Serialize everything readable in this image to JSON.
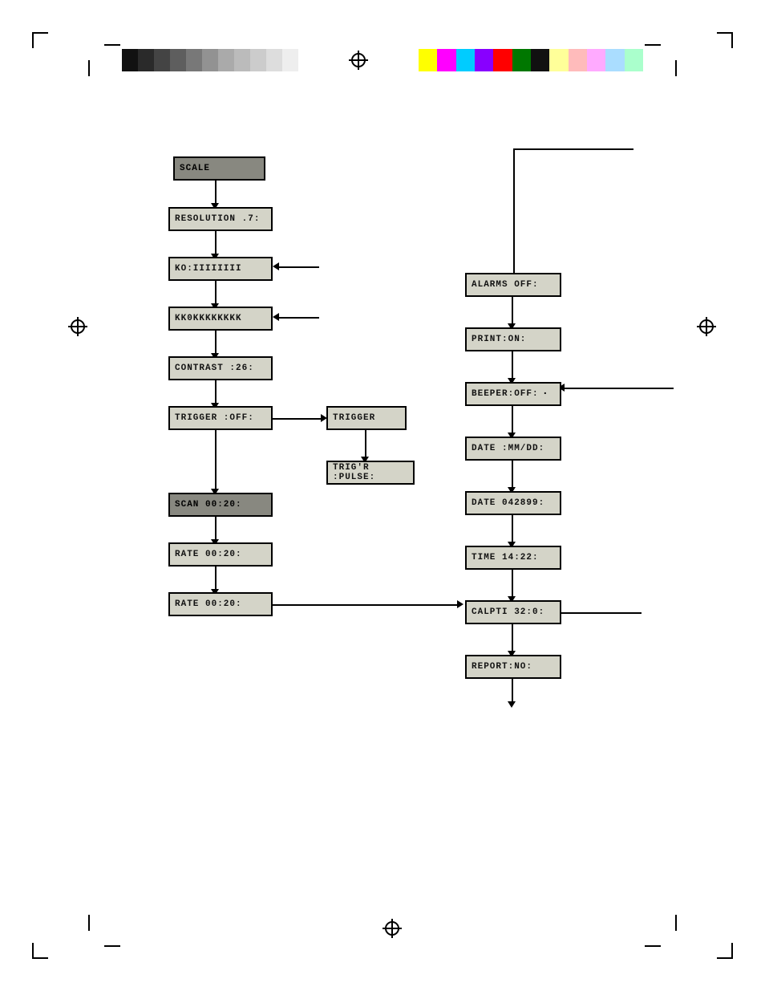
{
  "colorBars": {
    "grayscale": [
      "#111111",
      "#333333",
      "#555555",
      "#777777",
      "#999999",
      "#aaaaaa",
      "#bbbbbb",
      "#cccccc",
      "#dddddd",
      "#eeeeee",
      "#ffffff"
    ],
    "colors": [
      "#ffff00",
      "#ff00ff",
      "#00ffff",
      "#0000ff",
      "#ff0000",
      "#00aa00",
      "#000000",
      "#ffff88",
      "#ffaaaa",
      "#aaaaff",
      "#88ffff",
      "#88ff88"
    ]
  },
  "boxes": {
    "scale": "SCALE",
    "resolution": "RESOLUTION .7:",
    "row1": "KO:IIIIIIII",
    "row2": "KK0KKKKKKKK",
    "contrast": "CONTRAST :26:",
    "trigger_off": "TRIGGER :OFF:",
    "trigger": "TRIGGER",
    "trigr_pulse": "TRIG'R :PULSE:",
    "scan": "SCAN    00:20:",
    "rate1": "RATE    00:20:",
    "rate2": "RATE    00:20:",
    "alarms": "ALARMS  OFF:",
    "print": "PRINT:ON:",
    "beeper": "BEEPER:OFF:",
    "date_fmt": "DATE :MM/DD:",
    "date_val": "DATE 042899:",
    "time": "TIME   14:22:",
    "calpti": "CALPTI  32:0:",
    "report": "REPORT:NO:"
  }
}
